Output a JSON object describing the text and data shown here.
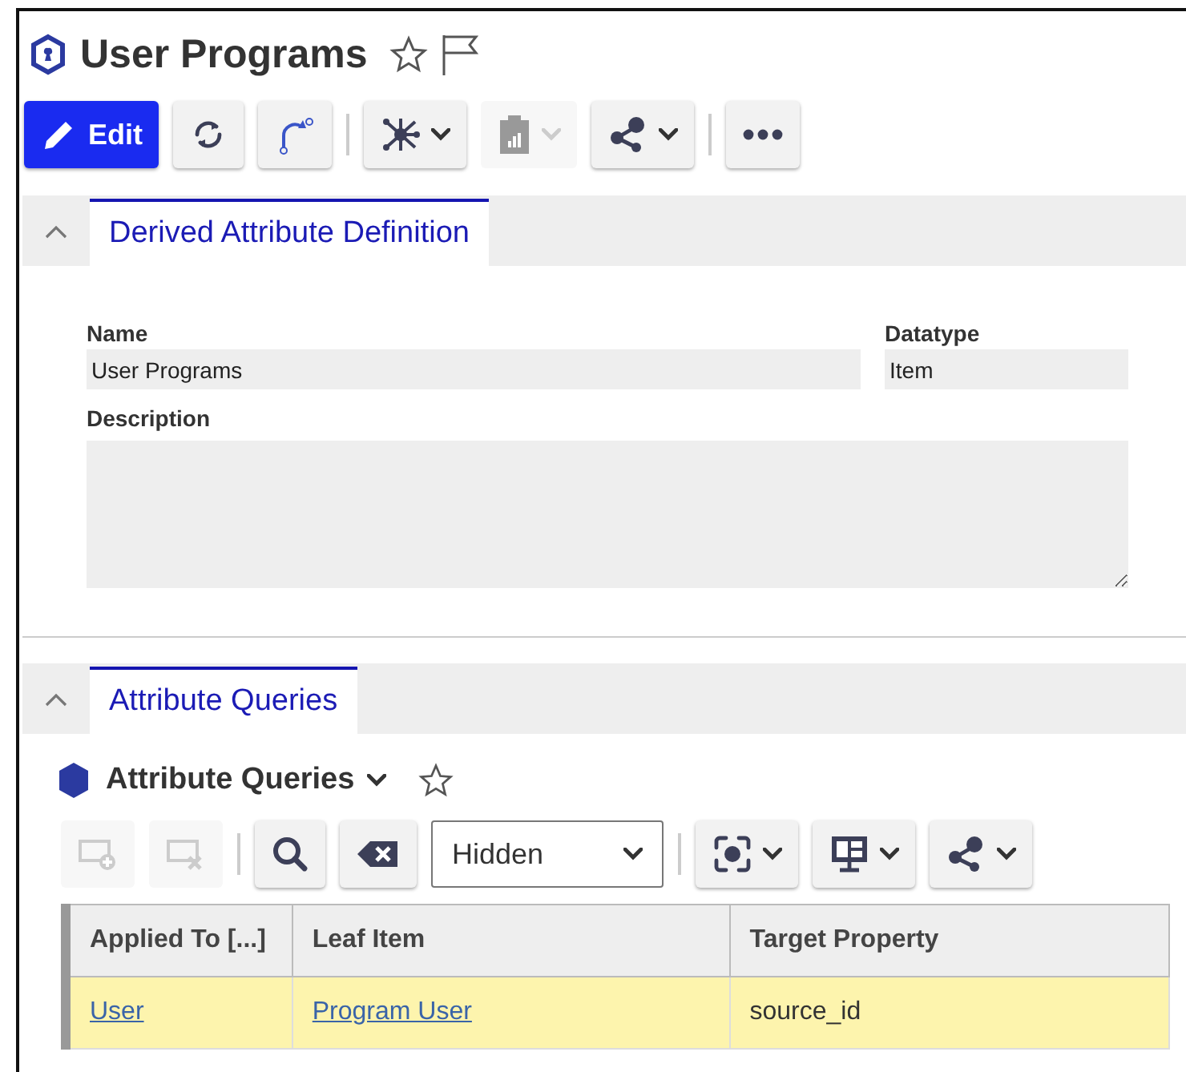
{
  "title": "User Programs",
  "favorite": false,
  "toolbar": [
    {
      "kind": "primary",
      "label": "Edit",
      "disabled": false
    },
    {
      "kind": "button",
      "disabled": false
    },
    {
      "kind": "button",
      "disabled": false
    },
    {
      "kind": "separator"
    },
    {
      "kind": "menu",
      "disabled": false
    },
    {
      "kind": "menu",
      "disabled": true
    },
    {
      "kind": "menu",
      "disabled": false
    },
    {
      "kind": "separator"
    },
    {
      "kind": "button",
      "disabled": false
    }
  ],
  "sections": [
    {
      "tab": "Derived Attribute Definition",
      "expanded": true,
      "fields": [
        {
          "label": "Name",
          "value": "User Programs"
        },
        {
          "label": "Datatype",
          "value": "Item"
        },
        {
          "label": "Description"
        }
      ]
    },
    {
      "tab": "Attribute Queries",
      "expanded": true,
      "grid_title": "Attribute Queries",
      "grid_toolbar": [
        {
          "kind": "button",
          "disabled": true
        },
        {
          "kind": "button",
          "disabled": true
        },
        {
          "kind": "separator"
        },
        {
          "kind": "button",
          "disabled": false
        },
        {
          "kind": "button",
          "disabled": false
        },
        {
          "kind": "select",
          "value": "Hidden"
        },
        {
          "kind": "separator"
        },
        {
          "kind": "menu",
          "disabled": false
        },
        {
          "kind": "menu",
          "disabled": false
        },
        {
          "kind": "menu",
          "disabled": false
        }
      ],
      "table": {
        "columns": [
          "Applied To [...]",
          "Leaf Item",
          "Target Property"
        ],
        "rows": [
          {
            "selected": true,
            "cells": [
              {
                "kind": "link",
                "text": "User"
              },
              {
                "kind": "link",
                "text": "Program User"
              },
              {
                "kind": "text",
                "text": "source_id"
              }
            ]
          }
        ]
      }
    }
  ]
}
